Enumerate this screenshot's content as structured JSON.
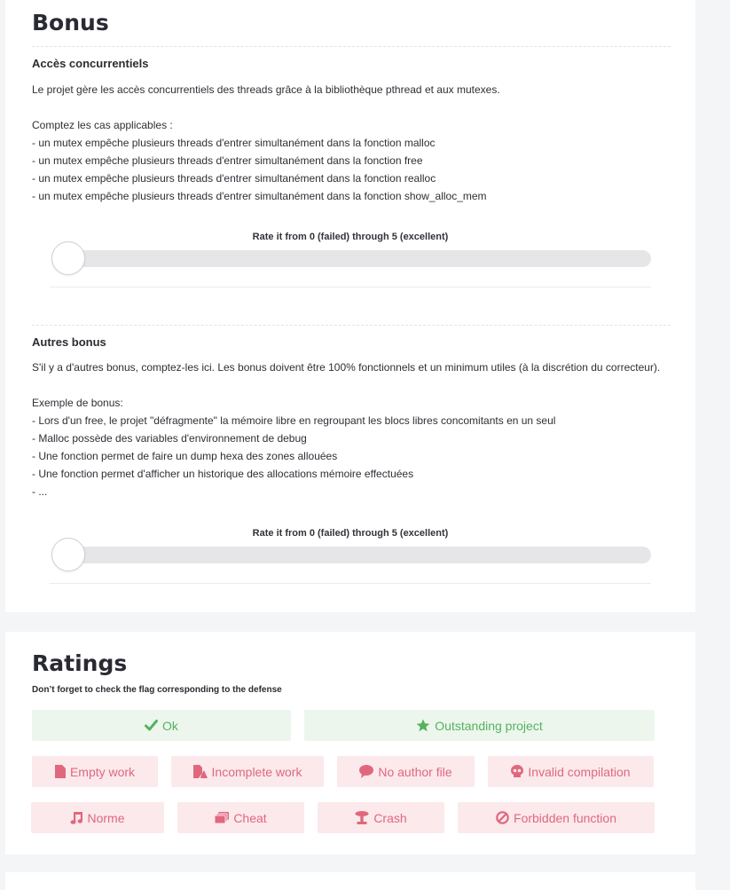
{
  "bonus": {
    "title": "Bonus",
    "sections": [
      {
        "title": "Accès concurrentiels",
        "lines": [
          "Le projet gère les accès concurrentiels des threads grâce à la bibliothèque pthread et aux mutexes.",
          "",
          "Comptez les cas applicables :",
          "- un mutex empêche plusieurs threads d'entrer simultanément dans la fonction malloc",
          "- un mutex empêche plusieurs threads d'entrer simultanément dans la fonction free",
          "- un mutex empêche plusieurs threads d'entrer simultanément dans la fonction realloc",
          "- un mutex empêche plusieurs threads d'entrer simultanément dans la fonction show_alloc_mem"
        ],
        "rate_label": "Rate it from 0 (failed) through 5 (excellent)",
        "rating_value": 0,
        "rating_max": 5
      },
      {
        "title": "Autres bonus",
        "lines": [
          "S'il y a d'autres bonus, comptez-les ici. Les bonus doivent être 100% fonctionnels et un minimum utiles (à la discrétion du correcteur).",
          "",
          "Exemple de bonus:",
          "- Lors d'un free, le projet \"défragmente\" la mémoire libre en regroupant les blocs libres concomitants en un seul",
          "- Malloc possède des variables d'environnement de debug",
          "- Une fonction permet de faire un dump hexa des zones allouées",
          "- Une fonction permet d'afficher un historique des allocations mémoire effectuées",
          "- ..."
        ],
        "rate_label": "Rate it from 0 (failed) through 5 (excellent)",
        "rating_value": 0,
        "rating_max": 5
      }
    ]
  },
  "ratings": {
    "title": "Ratings",
    "note": "Don’t forget to check the flag corresponding to the defense",
    "flags": {
      "ok": {
        "label": "Ok",
        "icon": "check-icon"
      },
      "outstanding": {
        "label": "Outstanding project",
        "icon": "star-icon"
      },
      "empty": {
        "label": "Empty work",
        "icon": "file-icon"
      },
      "incomplete": {
        "label": "Incomplete work",
        "icon": "file-broken-icon"
      },
      "no_author": {
        "label": "No author file",
        "icon": "speech-bubble-icon"
      },
      "invalid_compilation": {
        "label": "Invalid compilation",
        "icon": "skull-icon"
      },
      "norme": {
        "label": "Norme",
        "icon": "music-note-icon"
      },
      "cheat": {
        "label": "Cheat",
        "icon": "cards-icon"
      },
      "crash": {
        "label": "Crash",
        "icon": "explosion-icon"
      },
      "forbidden": {
        "label": "Forbidden function",
        "icon": "forbidden-icon"
      }
    },
    "colors": {
      "positive_bg": "#ecf6ed",
      "positive_text": "#55b25f",
      "negative_bg": "#fbe9ec",
      "negative_text": "#e0687d"
    }
  }
}
